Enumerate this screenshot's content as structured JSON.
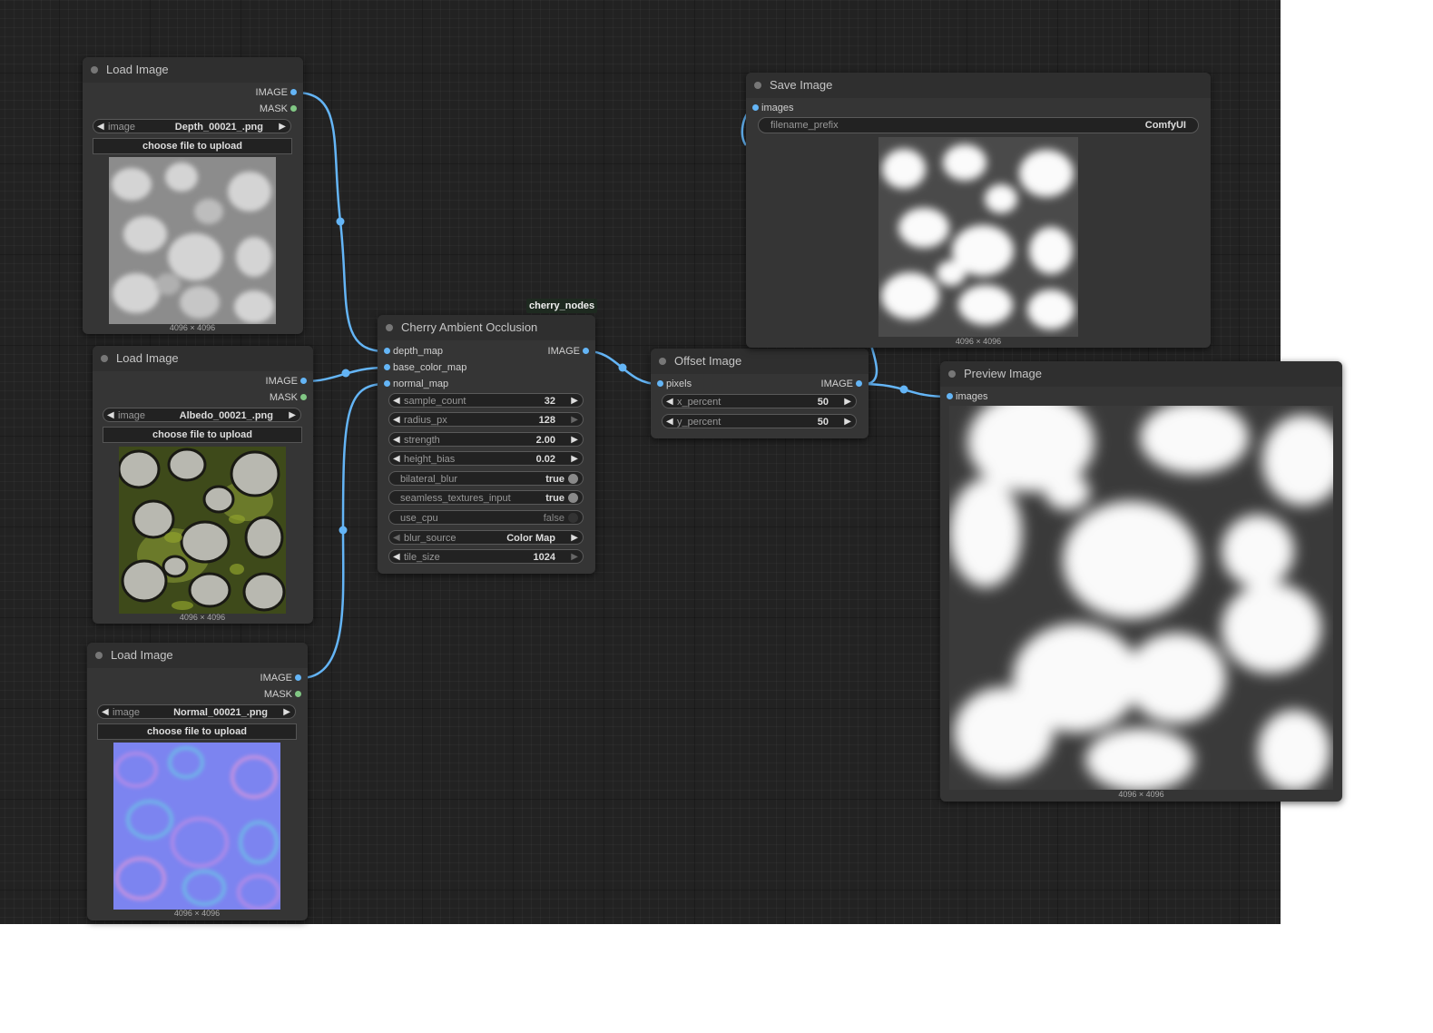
{
  "nodes": {
    "load_depth": {
      "title": "Load Image",
      "outputs": [
        "IMAGE",
        "MASK"
      ],
      "image_widget": {
        "label": "image",
        "value": "Depth_00021_.png"
      },
      "upload_label": "choose file to upload",
      "dimensions": "4096 × 4096"
    },
    "load_albedo": {
      "title": "Load Image",
      "outputs": [
        "IMAGE",
        "MASK"
      ],
      "image_widget": {
        "label": "image",
        "value": "Albedo_00021_.png"
      },
      "upload_label": "choose file to upload",
      "dimensions": "4096 × 4096"
    },
    "load_normal": {
      "title": "Load Image",
      "outputs": [
        "IMAGE",
        "MASK"
      ],
      "image_widget": {
        "label": "image",
        "value": "Normal_00021_.png"
      },
      "upload_label": "choose file to upload",
      "dimensions": "4096 × 4096"
    },
    "cherry_ao": {
      "group_tag": "cherry_nodes",
      "title": "Cherry Ambient Occlusion",
      "inputs": [
        "depth_map",
        "base_color_map",
        "normal_map"
      ],
      "output": "IMAGE",
      "widgets": [
        {
          "label": "sample_count",
          "value": "32"
        },
        {
          "label": "radius_px",
          "value": "128"
        },
        {
          "label": "strength",
          "value": "2.00"
        },
        {
          "label": "height_bias",
          "value": "0.02"
        },
        {
          "label": "bilateral_blur",
          "value": "true"
        },
        {
          "label": "seamless_textures_input",
          "value": "true"
        },
        {
          "label": "use_cpu",
          "value": "false"
        },
        {
          "label": "blur_source",
          "value": "Color Map"
        },
        {
          "label": "tile_size",
          "value": "1024"
        }
      ]
    },
    "offset": {
      "title": "Offset Image",
      "input": "pixels",
      "output": "IMAGE",
      "widgets": [
        {
          "label": "x_percent",
          "value": "50"
        },
        {
          "label": "y_percent",
          "value": "50"
        }
      ]
    },
    "save": {
      "title": "Save Image",
      "input": "images",
      "prefix_widget": {
        "label": "filename_prefix",
        "value": "ComfyUI"
      },
      "dimensions": "4096 × 4096"
    },
    "preview": {
      "title": "Preview Image",
      "input": "images",
      "dimensions": "4096 × 4096"
    }
  },
  "colors": {
    "canvas": "#222222",
    "node": "#353535",
    "link_image": "#64b5f6",
    "link_mask": "#81c784"
  },
  "icons": {
    "node_status": "circle-dot-icon",
    "decrement": "triangle-left-icon",
    "increment": "triangle-right-icon"
  }
}
